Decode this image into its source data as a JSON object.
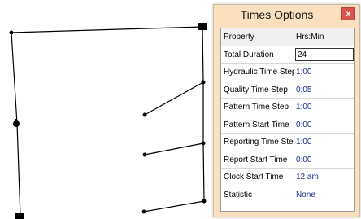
{
  "dialog": {
    "title": "Times Options",
    "close_label": "x",
    "header": {
      "property": "Property",
      "value": "Hrs:Min"
    },
    "rows": [
      {
        "property": "Total Duration",
        "value": "24"
      },
      {
        "property": "Hydraulic Time Step",
        "value": "1:00"
      },
      {
        "property": "Quality Time Step",
        "value": "0:05"
      },
      {
        "property": "Pattern Time Step",
        "value": "1:00"
      },
      {
        "property": "Pattern Start Time",
        "value": "0:00"
      },
      {
        "property": "Reporting Time Step",
        "value": "1:00"
      },
      {
        "property": "Report Start Time",
        "value": "0:00"
      },
      {
        "property": "Clock Start Time",
        "value": "12 am"
      },
      {
        "property": "Statistic",
        "value": "None"
      }
    ]
  }
}
